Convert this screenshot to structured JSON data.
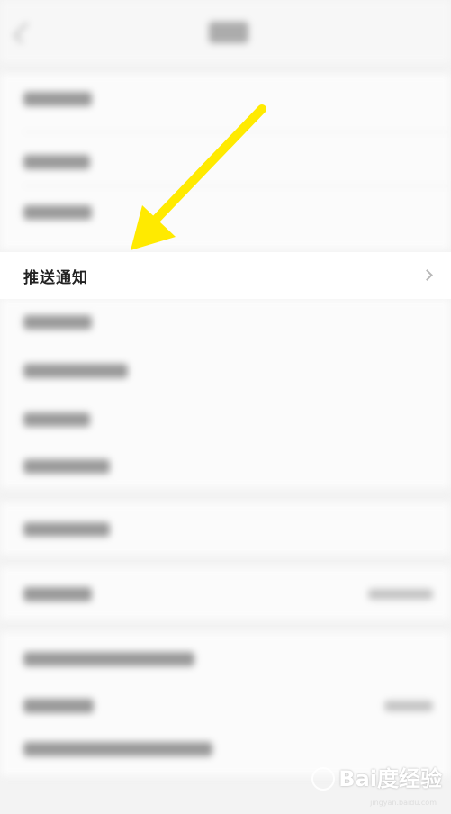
{
  "settings": {
    "highlighted_item": {
      "label": "推送通知"
    }
  },
  "watermark": {
    "brand": "Bai度经验",
    "domain": "jingyan.baidu.com"
  },
  "colors": {
    "annotation_arrow": "#ffea00",
    "highlight_row_bg": "#ffffff",
    "blurred_bg": "#f3f3f3"
  },
  "icons": {
    "row_chevron": "chevron-right-icon",
    "annotation": "arrow-icon"
  }
}
